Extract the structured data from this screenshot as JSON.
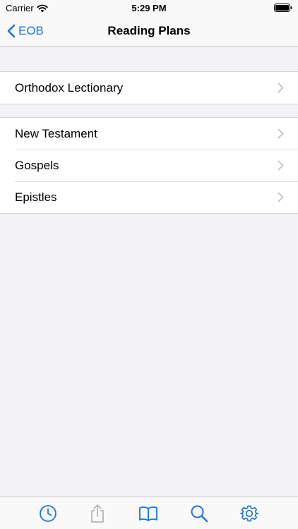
{
  "status_bar": {
    "carrier": "Carrier",
    "time": "5:29 PM"
  },
  "nav": {
    "back_label": "EOB",
    "title": "Reading Plans"
  },
  "sections": [
    {
      "items": [
        {
          "label": "Orthodox Lectionary"
        }
      ]
    },
    {
      "items": [
        {
          "label": "New Testament"
        },
        {
          "label": "Gospels"
        },
        {
          "label": "Epistles"
        }
      ]
    }
  ],
  "tab_bar": {
    "tabs": [
      {
        "icon": "clock-icon",
        "state": "normal"
      },
      {
        "icon": "share-icon",
        "state": "disabled"
      },
      {
        "icon": "book-icon",
        "state": "normal"
      },
      {
        "icon": "search-icon",
        "state": "normal"
      },
      {
        "icon": "gear-icon",
        "state": "normal"
      }
    ]
  },
  "colors": {
    "accent": "#1a73e8",
    "background": "#f2f2f7",
    "chevron": "#c7c7cc",
    "disabled": "#b5b5ba"
  }
}
